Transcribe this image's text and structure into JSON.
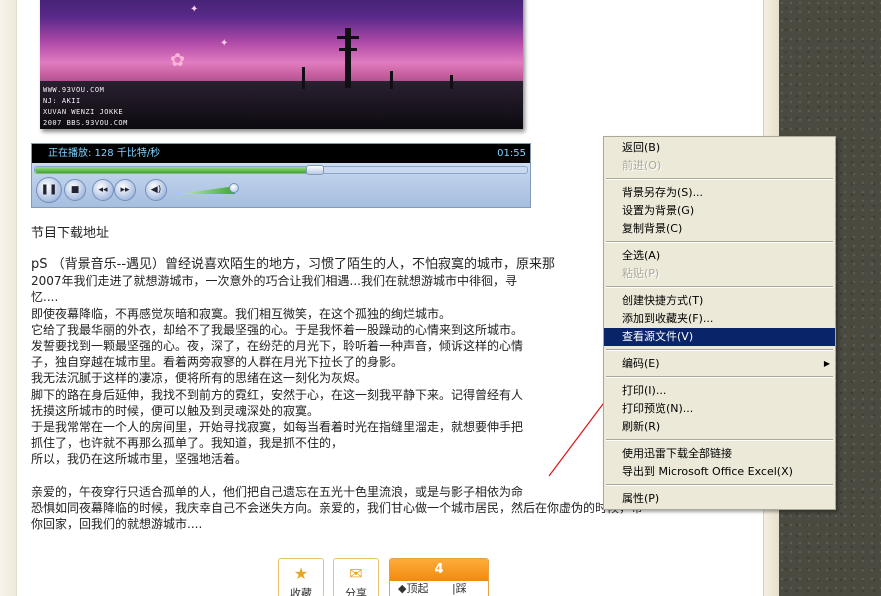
{
  "photo": {
    "credits": [
      "WWW.93VOU.COM",
      "NJ: AKII",
      "XUVAN WENZI JOKKE",
      "2007 BBS.93VOU.COM"
    ],
    "sky_colors": [
      "#5a2a8a",
      "#e07cc0"
    ]
  },
  "player": {
    "status_text": "正在播放: 128 千比特/秒",
    "time": "01:55",
    "progress": 0.56,
    "volume": 0.95,
    "buttons": [
      "pause",
      "stop",
      "previous",
      "next",
      "mute"
    ]
  },
  "download_title": "节目下载地址",
  "article": {
    "lines": [
      "pS （背景音乐--遇见）曾经说喜欢陌生的地方，习惯了陌生的人，不怕寂寞的城市，原来那",
      "2007年我们走进了就想游城市，一次意外的巧合让我们相遇...我们在就想游城市中徘徊，寻",
      "忆....",
      "即使夜幕降临，不再感觉灰暗和寂寞。我们相互微笑，在这个孤独的绚烂城市。",
      "它给了我最华丽的外衣，却给不了我最坚强的心。于是我怀着一股躁动的心情来到这所城市。",
      "发誓要找到一颗最坚强的心。夜，深了，在纷茫的月光下，聆听着一种声音，倾诉这样的心情",
      "子，独自穿越在城市里。看着两旁寂寥的人群在月光下拉长了的身影。",
      "我无法沉腻于这样的凄凉，便将所有的思绪在这一刻化为灰烬。",
      "脚下的路在身后延伸，我找不到前方的霓红，安然于心，在这一刻我平静下来。记得曾经有人",
      "抚摸这所城市的时候，便可以触及到灵魂深处的寂寞。",
      "于是我常常在一个人的房间里，开始寻找寂寞，如每当看着时光在指缝里溜走，就想要伸手把",
      "抓住了，也许就不再那么孤单了。我知道，我是抓不住的，",
      "所以，我仍在这所城市里，坚强地活着。",
      "",
      "亲爱的，午夜穿行只适合孤单的人，他们把自己遗忘在五光十色里流浪，或是与影子相依为命",
      "恐惧如同夜幕降临的时候，我庆幸自己不会迷失方向。亲爱的，我们甘心做一个城市居民，然后在你虚伪的时候，带",
      "你回家，回我们的就想游城市...."
    ]
  },
  "share": {
    "favorite_label": "收藏",
    "share_label": "分享",
    "vote_count": "4",
    "up_label": "顶起",
    "down_label": "踩底"
  },
  "context_menu": {
    "items": [
      {
        "label": "返回(B)",
        "type": "item"
      },
      {
        "label": "前进(O)",
        "type": "disabled"
      },
      {
        "type": "separator"
      },
      {
        "label": "背景另存为(S)...",
        "type": "item"
      },
      {
        "label": "设置为背景(G)",
        "type": "item"
      },
      {
        "label": "复制背景(C)",
        "type": "item"
      },
      {
        "type": "separator"
      },
      {
        "label": "全选(A)",
        "type": "item"
      },
      {
        "label": "粘贴(P)",
        "type": "disabled"
      },
      {
        "type": "separator"
      },
      {
        "label": "创建快捷方式(T)",
        "type": "item"
      },
      {
        "label": "添加到收藏夹(F)...",
        "type": "item"
      },
      {
        "label": "查看源文件(V)",
        "type": "selected"
      },
      {
        "type": "separator"
      },
      {
        "label": "编码(E)",
        "type": "submenu"
      },
      {
        "type": "separator"
      },
      {
        "label": "打印(I)...",
        "type": "item"
      },
      {
        "label": "打印预览(N)...",
        "type": "item"
      },
      {
        "label": "刷新(R)",
        "type": "item"
      },
      {
        "type": "separator"
      },
      {
        "label": "使用迅雷下载全部链接",
        "type": "item"
      },
      {
        "label": "导出到 Microsoft Office Excel(X)",
        "type": "item"
      },
      {
        "type": "separator"
      },
      {
        "label": "属性(P)",
        "type": "item"
      }
    ],
    "highlight_color": "#0a246a"
  },
  "annotation": {
    "arrow_color": "#e01010"
  }
}
